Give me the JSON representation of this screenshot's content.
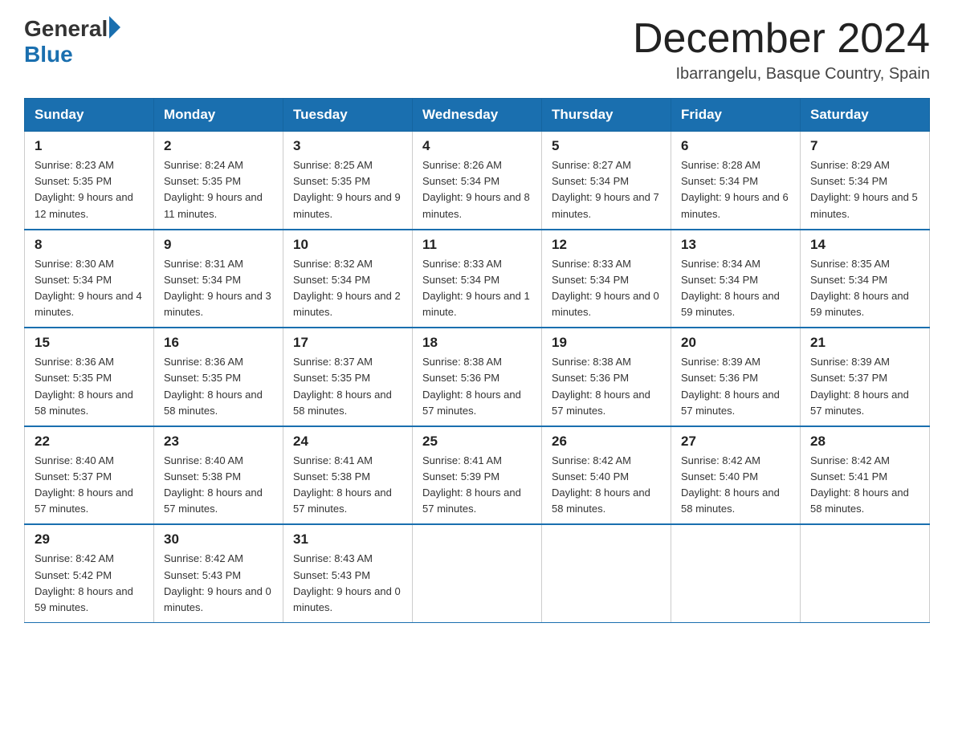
{
  "header": {
    "logo_general": "General",
    "logo_blue": "Blue",
    "month_title": "December 2024",
    "location": "Ibarrangelu, Basque Country, Spain"
  },
  "columns": [
    "Sunday",
    "Monday",
    "Tuesday",
    "Wednesday",
    "Thursday",
    "Friday",
    "Saturday"
  ],
  "weeks": [
    [
      {
        "day": "1",
        "sunrise": "Sunrise: 8:23 AM",
        "sunset": "Sunset: 5:35 PM",
        "daylight": "Daylight: 9 hours and 12 minutes."
      },
      {
        "day": "2",
        "sunrise": "Sunrise: 8:24 AM",
        "sunset": "Sunset: 5:35 PM",
        "daylight": "Daylight: 9 hours and 11 minutes."
      },
      {
        "day": "3",
        "sunrise": "Sunrise: 8:25 AM",
        "sunset": "Sunset: 5:35 PM",
        "daylight": "Daylight: 9 hours and 9 minutes."
      },
      {
        "day": "4",
        "sunrise": "Sunrise: 8:26 AM",
        "sunset": "Sunset: 5:34 PM",
        "daylight": "Daylight: 9 hours and 8 minutes."
      },
      {
        "day": "5",
        "sunrise": "Sunrise: 8:27 AM",
        "sunset": "Sunset: 5:34 PM",
        "daylight": "Daylight: 9 hours and 7 minutes."
      },
      {
        "day": "6",
        "sunrise": "Sunrise: 8:28 AM",
        "sunset": "Sunset: 5:34 PM",
        "daylight": "Daylight: 9 hours and 6 minutes."
      },
      {
        "day": "7",
        "sunrise": "Sunrise: 8:29 AM",
        "sunset": "Sunset: 5:34 PM",
        "daylight": "Daylight: 9 hours and 5 minutes."
      }
    ],
    [
      {
        "day": "8",
        "sunrise": "Sunrise: 8:30 AM",
        "sunset": "Sunset: 5:34 PM",
        "daylight": "Daylight: 9 hours and 4 minutes."
      },
      {
        "day": "9",
        "sunrise": "Sunrise: 8:31 AM",
        "sunset": "Sunset: 5:34 PM",
        "daylight": "Daylight: 9 hours and 3 minutes."
      },
      {
        "day": "10",
        "sunrise": "Sunrise: 8:32 AM",
        "sunset": "Sunset: 5:34 PM",
        "daylight": "Daylight: 9 hours and 2 minutes."
      },
      {
        "day": "11",
        "sunrise": "Sunrise: 8:33 AM",
        "sunset": "Sunset: 5:34 PM",
        "daylight": "Daylight: 9 hours and 1 minute."
      },
      {
        "day": "12",
        "sunrise": "Sunrise: 8:33 AM",
        "sunset": "Sunset: 5:34 PM",
        "daylight": "Daylight: 9 hours and 0 minutes."
      },
      {
        "day": "13",
        "sunrise": "Sunrise: 8:34 AM",
        "sunset": "Sunset: 5:34 PM",
        "daylight": "Daylight: 8 hours and 59 minutes."
      },
      {
        "day": "14",
        "sunrise": "Sunrise: 8:35 AM",
        "sunset": "Sunset: 5:34 PM",
        "daylight": "Daylight: 8 hours and 59 minutes."
      }
    ],
    [
      {
        "day": "15",
        "sunrise": "Sunrise: 8:36 AM",
        "sunset": "Sunset: 5:35 PM",
        "daylight": "Daylight: 8 hours and 58 minutes."
      },
      {
        "day": "16",
        "sunrise": "Sunrise: 8:36 AM",
        "sunset": "Sunset: 5:35 PM",
        "daylight": "Daylight: 8 hours and 58 minutes."
      },
      {
        "day": "17",
        "sunrise": "Sunrise: 8:37 AM",
        "sunset": "Sunset: 5:35 PM",
        "daylight": "Daylight: 8 hours and 58 minutes."
      },
      {
        "day": "18",
        "sunrise": "Sunrise: 8:38 AM",
        "sunset": "Sunset: 5:36 PM",
        "daylight": "Daylight: 8 hours and 57 minutes."
      },
      {
        "day": "19",
        "sunrise": "Sunrise: 8:38 AM",
        "sunset": "Sunset: 5:36 PM",
        "daylight": "Daylight: 8 hours and 57 minutes."
      },
      {
        "day": "20",
        "sunrise": "Sunrise: 8:39 AM",
        "sunset": "Sunset: 5:36 PM",
        "daylight": "Daylight: 8 hours and 57 minutes."
      },
      {
        "day": "21",
        "sunrise": "Sunrise: 8:39 AM",
        "sunset": "Sunset: 5:37 PM",
        "daylight": "Daylight: 8 hours and 57 minutes."
      }
    ],
    [
      {
        "day": "22",
        "sunrise": "Sunrise: 8:40 AM",
        "sunset": "Sunset: 5:37 PM",
        "daylight": "Daylight: 8 hours and 57 minutes."
      },
      {
        "day": "23",
        "sunrise": "Sunrise: 8:40 AM",
        "sunset": "Sunset: 5:38 PM",
        "daylight": "Daylight: 8 hours and 57 minutes."
      },
      {
        "day": "24",
        "sunrise": "Sunrise: 8:41 AM",
        "sunset": "Sunset: 5:38 PM",
        "daylight": "Daylight: 8 hours and 57 minutes."
      },
      {
        "day": "25",
        "sunrise": "Sunrise: 8:41 AM",
        "sunset": "Sunset: 5:39 PM",
        "daylight": "Daylight: 8 hours and 57 minutes."
      },
      {
        "day": "26",
        "sunrise": "Sunrise: 8:42 AM",
        "sunset": "Sunset: 5:40 PM",
        "daylight": "Daylight: 8 hours and 58 minutes."
      },
      {
        "day": "27",
        "sunrise": "Sunrise: 8:42 AM",
        "sunset": "Sunset: 5:40 PM",
        "daylight": "Daylight: 8 hours and 58 minutes."
      },
      {
        "day": "28",
        "sunrise": "Sunrise: 8:42 AM",
        "sunset": "Sunset: 5:41 PM",
        "daylight": "Daylight: 8 hours and 58 minutes."
      }
    ],
    [
      {
        "day": "29",
        "sunrise": "Sunrise: 8:42 AM",
        "sunset": "Sunset: 5:42 PM",
        "daylight": "Daylight: 8 hours and 59 minutes."
      },
      {
        "day": "30",
        "sunrise": "Sunrise: 8:42 AM",
        "sunset": "Sunset: 5:43 PM",
        "daylight": "Daylight: 9 hours and 0 minutes."
      },
      {
        "day": "31",
        "sunrise": "Sunrise: 8:43 AM",
        "sunset": "Sunset: 5:43 PM",
        "daylight": "Daylight: 9 hours and 0 minutes."
      },
      null,
      null,
      null,
      null
    ]
  ]
}
